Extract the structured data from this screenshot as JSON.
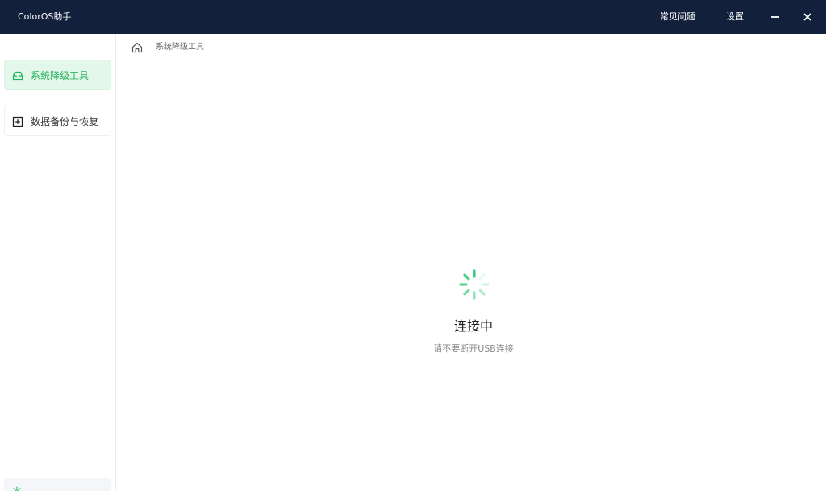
{
  "window": {
    "title": "ColorOS助手",
    "menu": {
      "faq": "常见问题",
      "settings": "设置"
    },
    "controls": [
      "minimize-icon",
      "close-icon"
    ]
  },
  "sidebar": {
    "items": [
      {
        "label": "系统降级工具",
        "icon": "inbox-icon",
        "active": true
      },
      {
        "label": "数据备份与恢复",
        "icon": "plus-square-icon",
        "active": false
      }
    ],
    "footer_icon": "sun-icon"
  },
  "breadcrumb": {
    "icon": "home-icon",
    "current": "系统降级工具"
  },
  "status": {
    "icon": "loading-spinner-icon",
    "title": "连接中",
    "subtitle": "请不要断开USB连接"
  },
  "colors": {
    "titlebar_bg": "#13203c",
    "accent_green": "#26b35e",
    "active_nav_bg": "#e3f8ea",
    "spinner_green": "#3ccf7f"
  }
}
